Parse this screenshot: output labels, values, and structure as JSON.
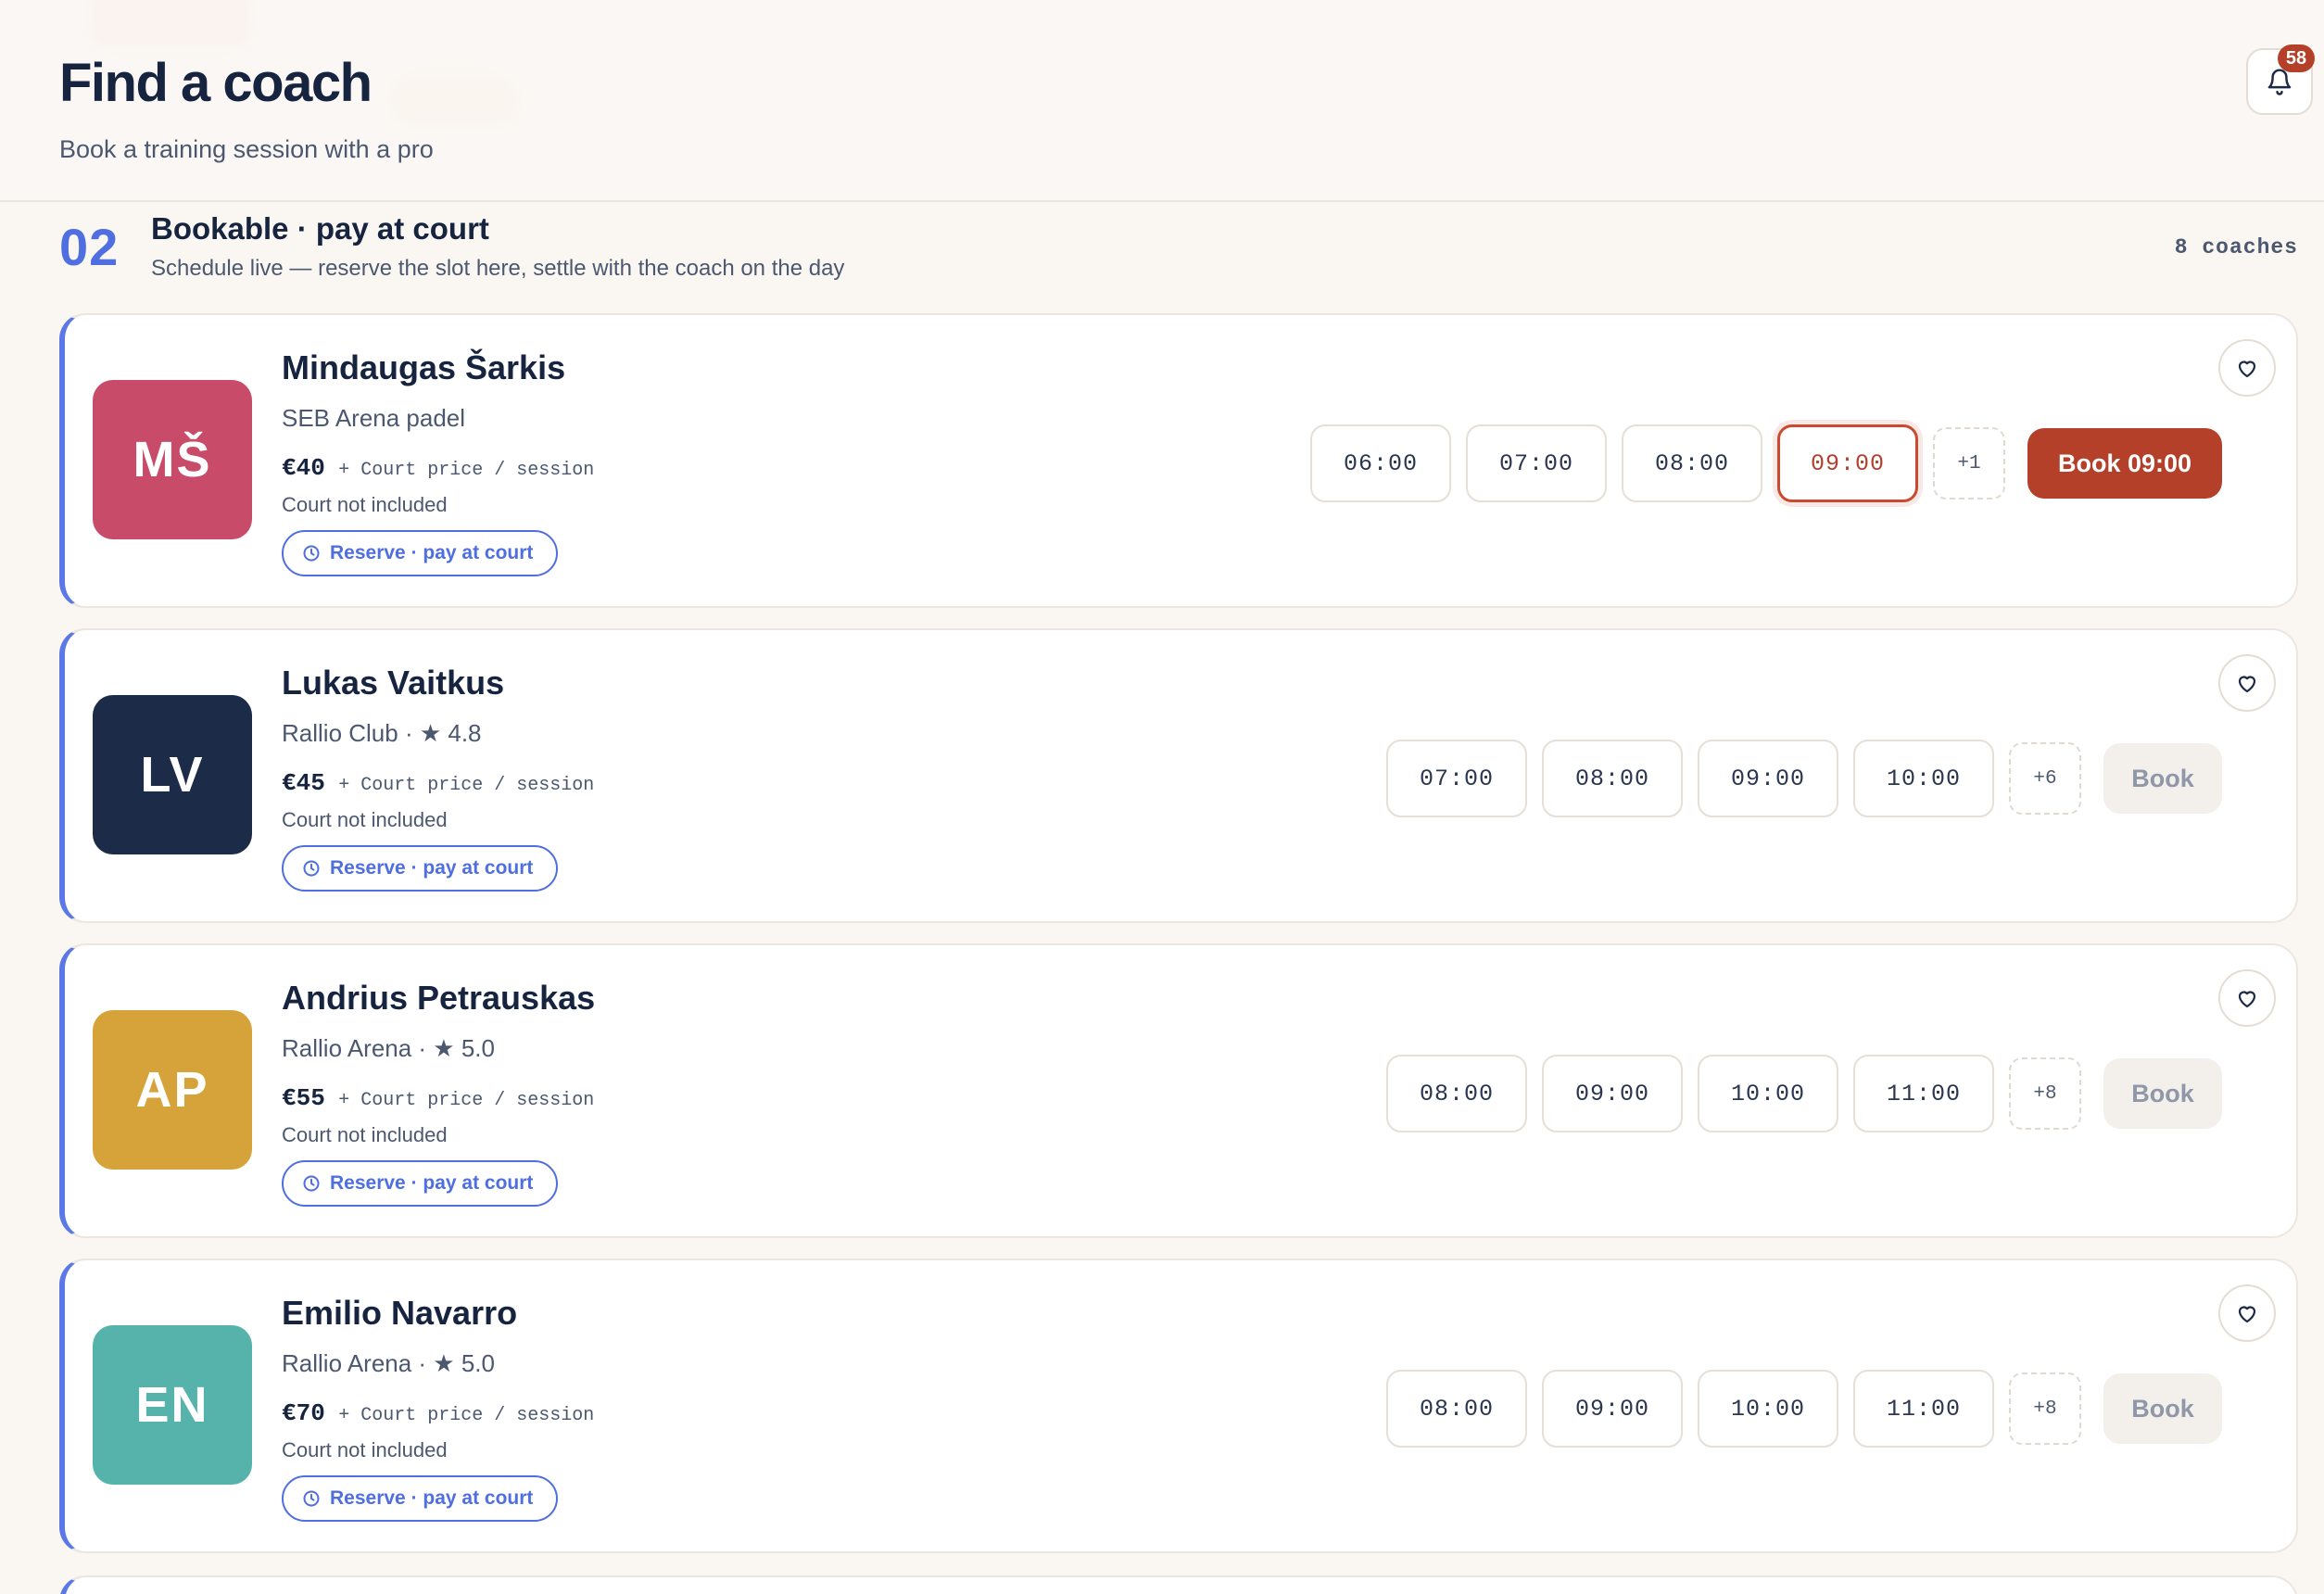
{
  "header": {
    "title": "Find a coach",
    "subtitle": "Book a training session with a pro",
    "notifications_count": "58"
  },
  "section": {
    "number": "02",
    "title": "Bookable · pay at court",
    "description": "Schedule live — reserve the slot here, settle with the coach on the day",
    "count_label": "8  coaches"
  },
  "colors": {
    "accent_blue": "#4f6ee0",
    "book_active": "#b5402a",
    "navy_text": "#16243f"
  },
  "coaches": [
    {
      "initials": "MŠ",
      "avatar_color": "#c84b6a",
      "name": "Mindaugas Šarkis",
      "venue": "SEB Arena padel",
      "price": "€40",
      "price_note": "+ Court price / session",
      "court_note": "Court not included",
      "reserve_label": "Reserve · pay at court",
      "slots": [
        "06:00",
        "07:00",
        "08:00",
        "09:00"
      ],
      "selected_slot": 3,
      "more": "+1",
      "book_label": "Book 09:00"
    },
    {
      "initials": "LV",
      "avatar_color": "#1c2b47",
      "name": "Lukas Vaitkus",
      "venue": "Rallio Club · ★ 4.8",
      "price": "€45",
      "price_note": "+ Court price / session",
      "court_note": "Court not included",
      "reserve_label": "Reserve · pay at court",
      "slots": [
        "07:00",
        "08:00",
        "09:00",
        "10:00"
      ],
      "selected_slot": -1,
      "more": "+6",
      "book_label": "Book"
    },
    {
      "initials": "AP",
      "avatar_color": "#d6a33a",
      "name": "Andrius Petrauskas",
      "venue": "Rallio Arena · ★ 5.0",
      "price": "€55",
      "price_note": "+ Court price / session",
      "court_note": "Court not included",
      "reserve_label": "Reserve · pay at court",
      "slots": [
        "08:00",
        "09:00",
        "10:00",
        "11:00"
      ],
      "selected_slot": -1,
      "more": "+8",
      "book_label": "Book"
    },
    {
      "initials": "EN",
      "avatar_color": "#55b3ab",
      "name": "Emilio Navarro",
      "venue": "Rallio Arena · ★ 5.0",
      "price": "€70",
      "price_note": "+ Court price / session",
      "court_note": "Court not included",
      "reserve_label": "Reserve · pay at court",
      "slots": [
        "08:00",
        "09:00",
        "10:00",
        "11:00"
      ],
      "selected_slot": -1,
      "more": "+8",
      "book_label": "Book"
    }
  ]
}
